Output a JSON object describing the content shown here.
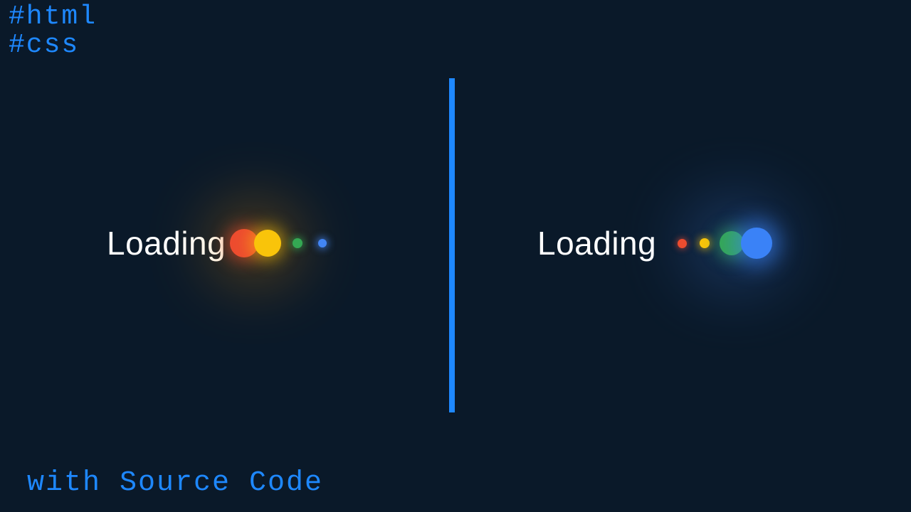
{
  "tags": {
    "line1": "#html",
    "line2": "#css"
  },
  "left": {
    "text": "Loading",
    "dots": [
      {
        "color": "#ed4c2f"
      },
      {
        "color": "#f9c40a"
      },
      {
        "color": "#34a853"
      },
      {
        "color": "#4285f4"
      }
    ]
  },
  "right": {
    "text": "Loading",
    "dots": [
      {
        "color": "#ed4c2f"
      },
      {
        "color": "#f9c40a"
      },
      {
        "color": "#34a853"
      },
      {
        "color": "#3a82f7"
      }
    ]
  },
  "footer": "with Source Code",
  "colors": {
    "accent": "#1e88ff",
    "background": "#0a1929"
  }
}
